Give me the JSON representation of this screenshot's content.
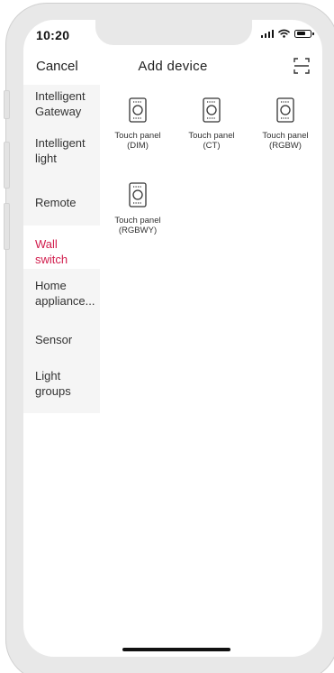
{
  "status_bar": {
    "time": "10:20",
    "icons": [
      "signal-icon",
      "wifi-icon",
      "battery-icon"
    ]
  },
  "header": {
    "cancel_label": "Cancel",
    "title": "Add device",
    "scan_icon": "scan-icon"
  },
  "sidebar": {
    "items": [
      {
        "label": "Intelligent\nGateway",
        "active": false
      },
      {
        "label": "Intelligent\nlight",
        "active": false
      },
      {
        "label": "Remote",
        "active": false
      },
      {
        "label": "Wall\nswitch",
        "active": true
      },
      {
        "label": "Home\nappliance...",
        "active": false
      },
      {
        "label": "Sensor",
        "active": false
      },
      {
        "label": "Light\ngroups",
        "active": false
      }
    ]
  },
  "devices": [
    {
      "label": "Touch panel\n(DIM)",
      "icon": "touch-panel-icon"
    },
    {
      "label": "Touch panel\n(CT)",
      "icon": "touch-panel-icon"
    },
    {
      "label": "Touch panel\n(RGBW)",
      "icon": "touch-panel-icon"
    },
    {
      "label": "Touch panel\n(RGBWY)",
      "icon": "touch-panel-icon"
    }
  ],
  "colors": {
    "accent": "#d11c4c",
    "sidebar_bg": "#f5f5f5",
    "frame": "#e8e8e8"
  }
}
